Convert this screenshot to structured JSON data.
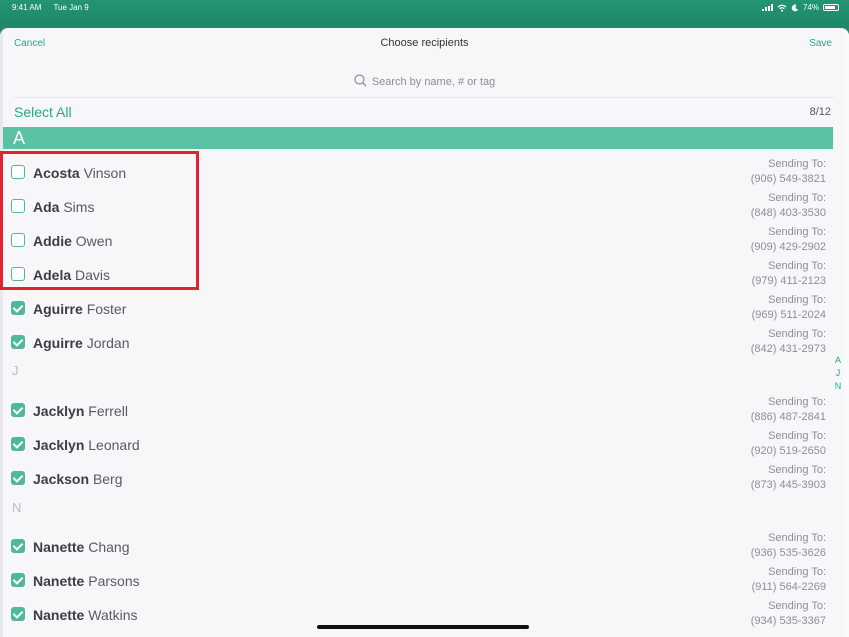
{
  "status": {
    "time": "9:41 AM",
    "date": "Tue Jan 9",
    "battery": "74%"
  },
  "nav": {
    "cancel": "Cancel",
    "title": "Choose recipients",
    "save": "Save"
  },
  "search": {
    "placeholder": "Search by name, # or tag"
  },
  "selection": {
    "select_all": "Select All",
    "count": "8/12"
  },
  "sections": {
    "a": "A",
    "j": "J",
    "n": "N"
  },
  "sending_label": "Sending To:",
  "contacts": [
    {
      "first": "Acosta",
      "last": "Vinson",
      "phone": "(906) 549-3821",
      "checked": false
    },
    {
      "first": "Ada",
      "last": "Sims",
      "phone": "(848) 403-3530",
      "checked": false
    },
    {
      "first": "Addie",
      "last": "Owen",
      "phone": "(909) 429-2902",
      "checked": false
    },
    {
      "first": "Adela",
      "last": "Davis",
      "phone": "(979) 411-2123",
      "checked": false
    },
    {
      "first": "Aguirre",
      "last": "Foster",
      "phone": "(969) 511-2024",
      "checked": true
    },
    {
      "first": "Aguirre",
      "last": "Jordan",
      "phone": "(842) 431-2973",
      "checked": true
    },
    {
      "first": "Jacklyn",
      "last": "Ferrell",
      "phone": "(886) 487-2841",
      "checked": true
    },
    {
      "first": "Jacklyn",
      "last": "Leonard",
      "phone": "(920) 519-2650",
      "checked": true
    },
    {
      "first": "Jackson",
      "last": "Berg",
      "phone": "(873) 445-3903",
      "checked": true
    },
    {
      "first": "Nanette",
      "last": "Chang",
      "phone": "(936) 535-3626",
      "checked": true
    },
    {
      "first": "Nanette",
      "last": "Parsons",
      "phone": "(911) 564-2269",
      "checked": true
    },
    {
      "first": "Nanette",
      "last": "Watkins",
      "phone": "(934) 535-3367",
      "checked": true
    }
  ],
  "index_letters": [
    "A",
    "J",
    "N"
  ],
  "colors": {
    "accent": "#23a98a",
    "section": "#5ac1a4",
    "highlight": "#e0242f"
  }
}
